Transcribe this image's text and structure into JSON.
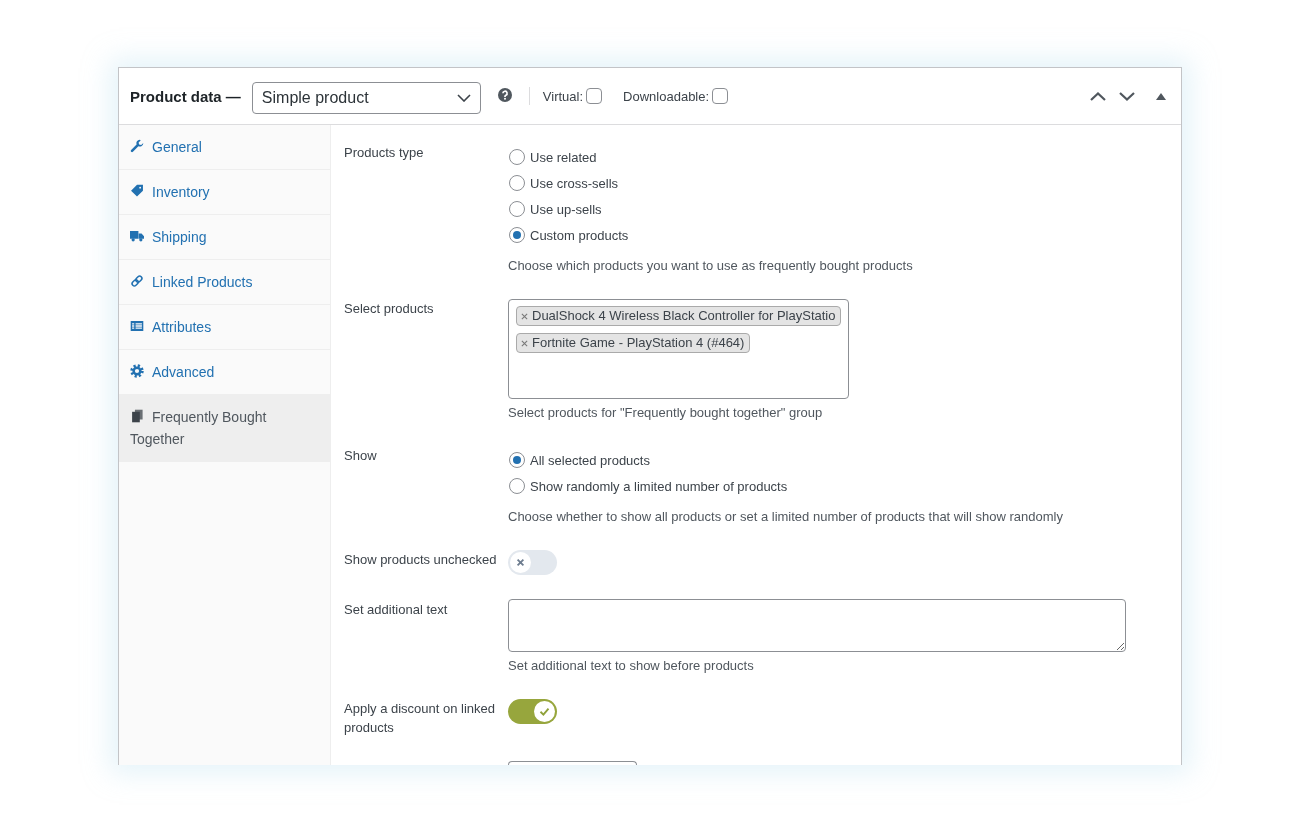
{
  "panel": {
    "title": "Product data —",
    "product_type": "Simple product",
    "checkboxes": [
      {
        "label": "Virtual:",
        "checked": false
      },
      {
        "label": "Downloadable:",
        "checked": false
      }
    ]
  },
  "tabs": [
    {
      "label": "General",
      "selected": false
    },
    {
      "label": "Inventory",
      "selected": false
    },
    {
      "label": "Shipping",
      "selected": false
    },
    {
      "label": "Linked Products",
      "selected": false
    },
    {
      "label": "Attributes",
      "selected": false
    },
    {
      "label": "Advanced",
      "selected": false
    },
    {
      "label": "Frequently Bought Together",
      "selected": true
    }
  ],
  "fields": [
    {
      "kind": "radio",
      "label": "Products type",
      "options": [
        {
          "label": "Use related",
          "selected": false
        },
        {
          "label": "Use cross-sells",
          "selected": false
        },
        {
          "label": "Use up-sells",
          "selected": false
        },
        {
          "label": "Custom products",
          "selected": true
        }
      ],
      "description": "Choose which products you want to use as frequently bought products"
    },
    {
      "kind": "multiselect",
      "label": "Select products",
      "tags": [
        "DualShock 4 Wireless Black Controller for PlayStatio",
        "Fortnite Game - PlayStation 4 (#464)"
      ],
      "description": "Select products for \"Frequently bought together\" group"
    },
    {
      "kind": "radio",
      "label": "Show",
      "options": [
        {
          "label": "All selected products",
          "selected": true
        },
        {
          "label": "Show randomly a limited number of products",
          "selected": false
        }
      ],
      "description": "Choose whether to show all products or set a limited number of products that will show randomly"
    },
    {
      "kind": "toggle",
      "label": "Show products unchecked",
      "on": false
    },
    {
      "kind": "textarea",
      "label": "Set additional text",
      "description": "Set additional text to show before products"
    },
    {
      "kind": "toggle",
      "label": "Apply a discount on linked products",
      "on": true
    },
    {
      "kind": "input"
    }
  ]
}
